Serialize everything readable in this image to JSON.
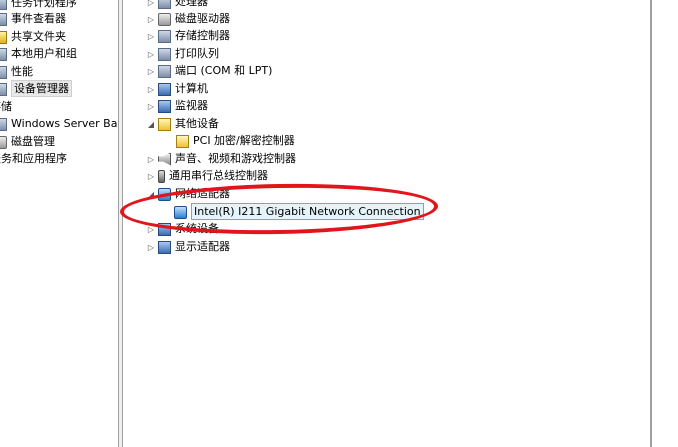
{
  "left_tree": {
    "items": [
      {
        "label": "任务计划程序",
        "icon": "task-scheduler-icon"
      },
      {
        "label": "事件查看器",
        "icon": "event-viewer-icon"
      },
      {
        "label": "共享文件夹",
        "icon": "shared-folder-icon"
      },
      {
        "label": "本地用户和组",
        "icon": "users-icon"
      },
      {
        "label": "性能",
        "icon": "performance-icon"
      },
      {
        "label": "设备管理器",
        "icon": "device-manager-icon",
        "selected": true
      },
      {
        "label": "存储",
        "icon": ""
      },
      {
        "label": "Windows Server Back",
        "icon": "backup-icon"
      },
      {
        "label": "磁盘管理",
        "icon": "disk-management-icon"
      },
      {
        "label": "服务和应用程序",
        "icon": ""
      }
    ]
  },
  "device_tree": {
    "items": [
      {
        "label": "处理器",
        "expanded": false,
        "icon": "processor-icon"
      },
      {
        "label": "磁盘驱动器",
        "expanded": false,
        "icon": "disk-drive-icon"
      },
      {
        "label": "存储控制器",
        "expanded": false,
        "icon": "storage-controller-icon"
      },
      {
        "label": "打印队列",
        "expanded": false,
        "icon": "printer-icon"
      },
      {
        "label": "端口 (COM 和 LPT)",
        "expanded": false,
        "icon": "port-icon"
      },
      {
        "label": "计算机",
        "expanded": false,
        "icon": "computer-icon"
      },
      {
        "label": "监视器",
        "expanded": false,
        "icon": "monitor-icon"
      },
      {
        "label": "其他设备",
        "expanded": true,
        "icon": "other-devices-icon"
      },
      {
        "label": "PCI 加密/解密控制器",
        "child": true,
        "icon": "warning-device-icon"
      },
      {
        "label": "声音、视频和游戏控制器",
        "expanded": false,
        "icon": "sound-icon"
      },
      {
        "label": "通用串行总线控制器",
        "expanded": false,
        "icon": "usb-icon"
      },
      {
        "label": "网络适配器",
        "expanded": true,
        "icon": "network-adapter-icon"
      },
      {
        "label": "Intel(R) I211 Gigabit Network Connection",
        "child": true,
        "selected": true,
        "icon": "network-card-icon"
      },
      {
        "label": "系统设备",
        "expanded": false,
        "icon": "system-devices-icon"
      },
      {
        "label": "显示适配器",
        "expanded": false,
        "icon": "display-adapter-icon"
      }
    ]
  },
  "colors": {
    "annotation": "#e0161c",
    "selection_bg": "#e5f3fb",
    "selection_border": "#7da2ce"
  }
}
